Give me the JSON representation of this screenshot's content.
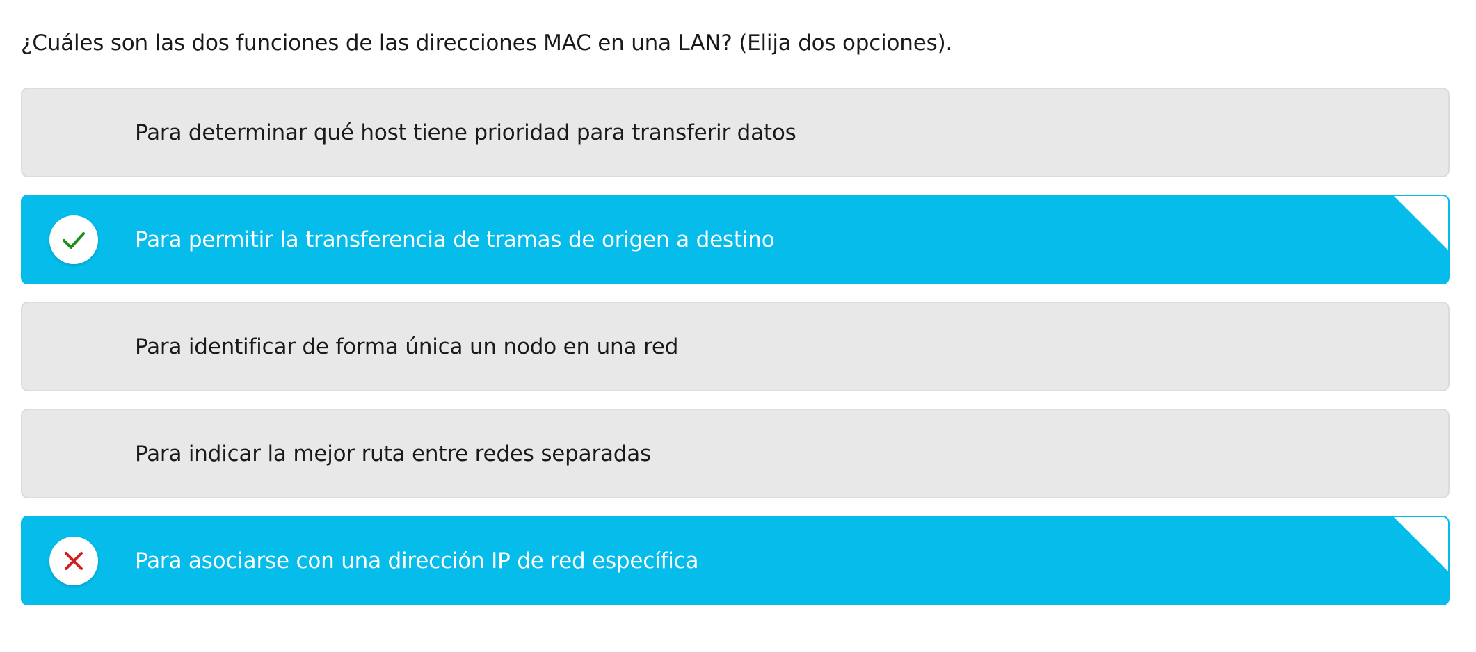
{
  "question": {
    "text": "¿Cuáles son las dos funciones de las direcciones MAC en una LAN? (Elija dos opciones)."
  },
  "options": [
    {
      "label": "Para determinar qué host tiene prioridad para transferir datos",
      "selected": false,
      "status": "none"
    },
    {
      "label": "Para permitir la transferencia de tramas de origen a destino",
      "selected": true,
      "status": "correct",
      "icon": "check-icon",
      "icon_color": "#1a8f1a"
    },
    {
      "label": "Para identificar de forma única un nodo en una red",
      "selected": false,
      "status": "none"
    },
    {
      "label": "Para indicar la mejor ruta entre redes separadas",
      "selected": false,
      "status": "none"
    },
    {
      "label": "Para asociarse con una dirección IP de red específica",
      "selected": true,
      "status": "incorrect",
      "icon": "cross-icon",
      "icon_color": "#d01f1f"
    }
  ],
  "colors": {
    "selected_bg": "#05bceb",
    "unselected_bg": "#e8e8e9",
    "unselected_border": "#dcdcde",
    "question_text": "#1a1a1a"
  }
}
